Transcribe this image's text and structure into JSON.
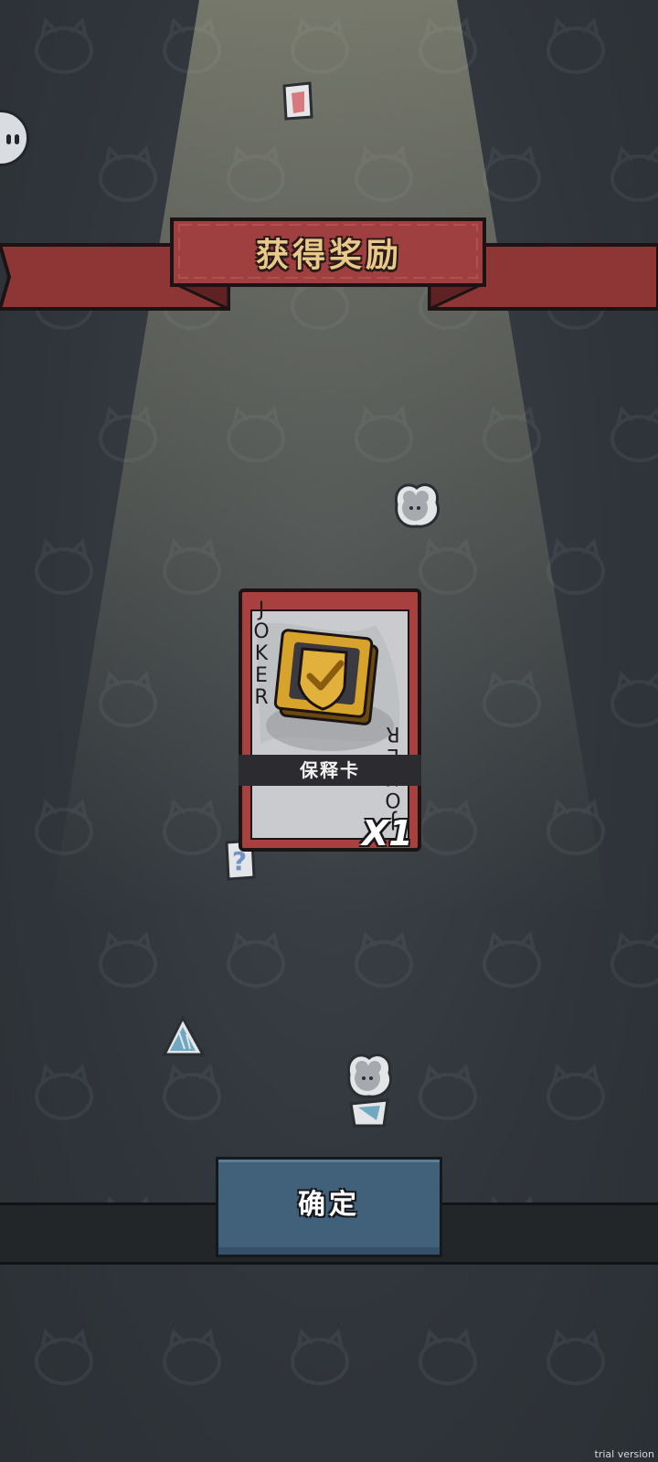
{
  "reward_title": "获得奖励",
  "card": {
    "top_label": "JOKER",
    "bottom_label": "JOKER",
    "name": "保释卡",
    "count": "X1",
    "icon": "shield-check-icon"
  },
  "confirm_label": "确定",
  "watermark": "trial version",
  "colors": {
    "banner_red": "#9a3b3c",
    "card_red": "#a8403f",
    "button_blue": "#41607a",
    "gold": "#d8a32a"
  }
}
